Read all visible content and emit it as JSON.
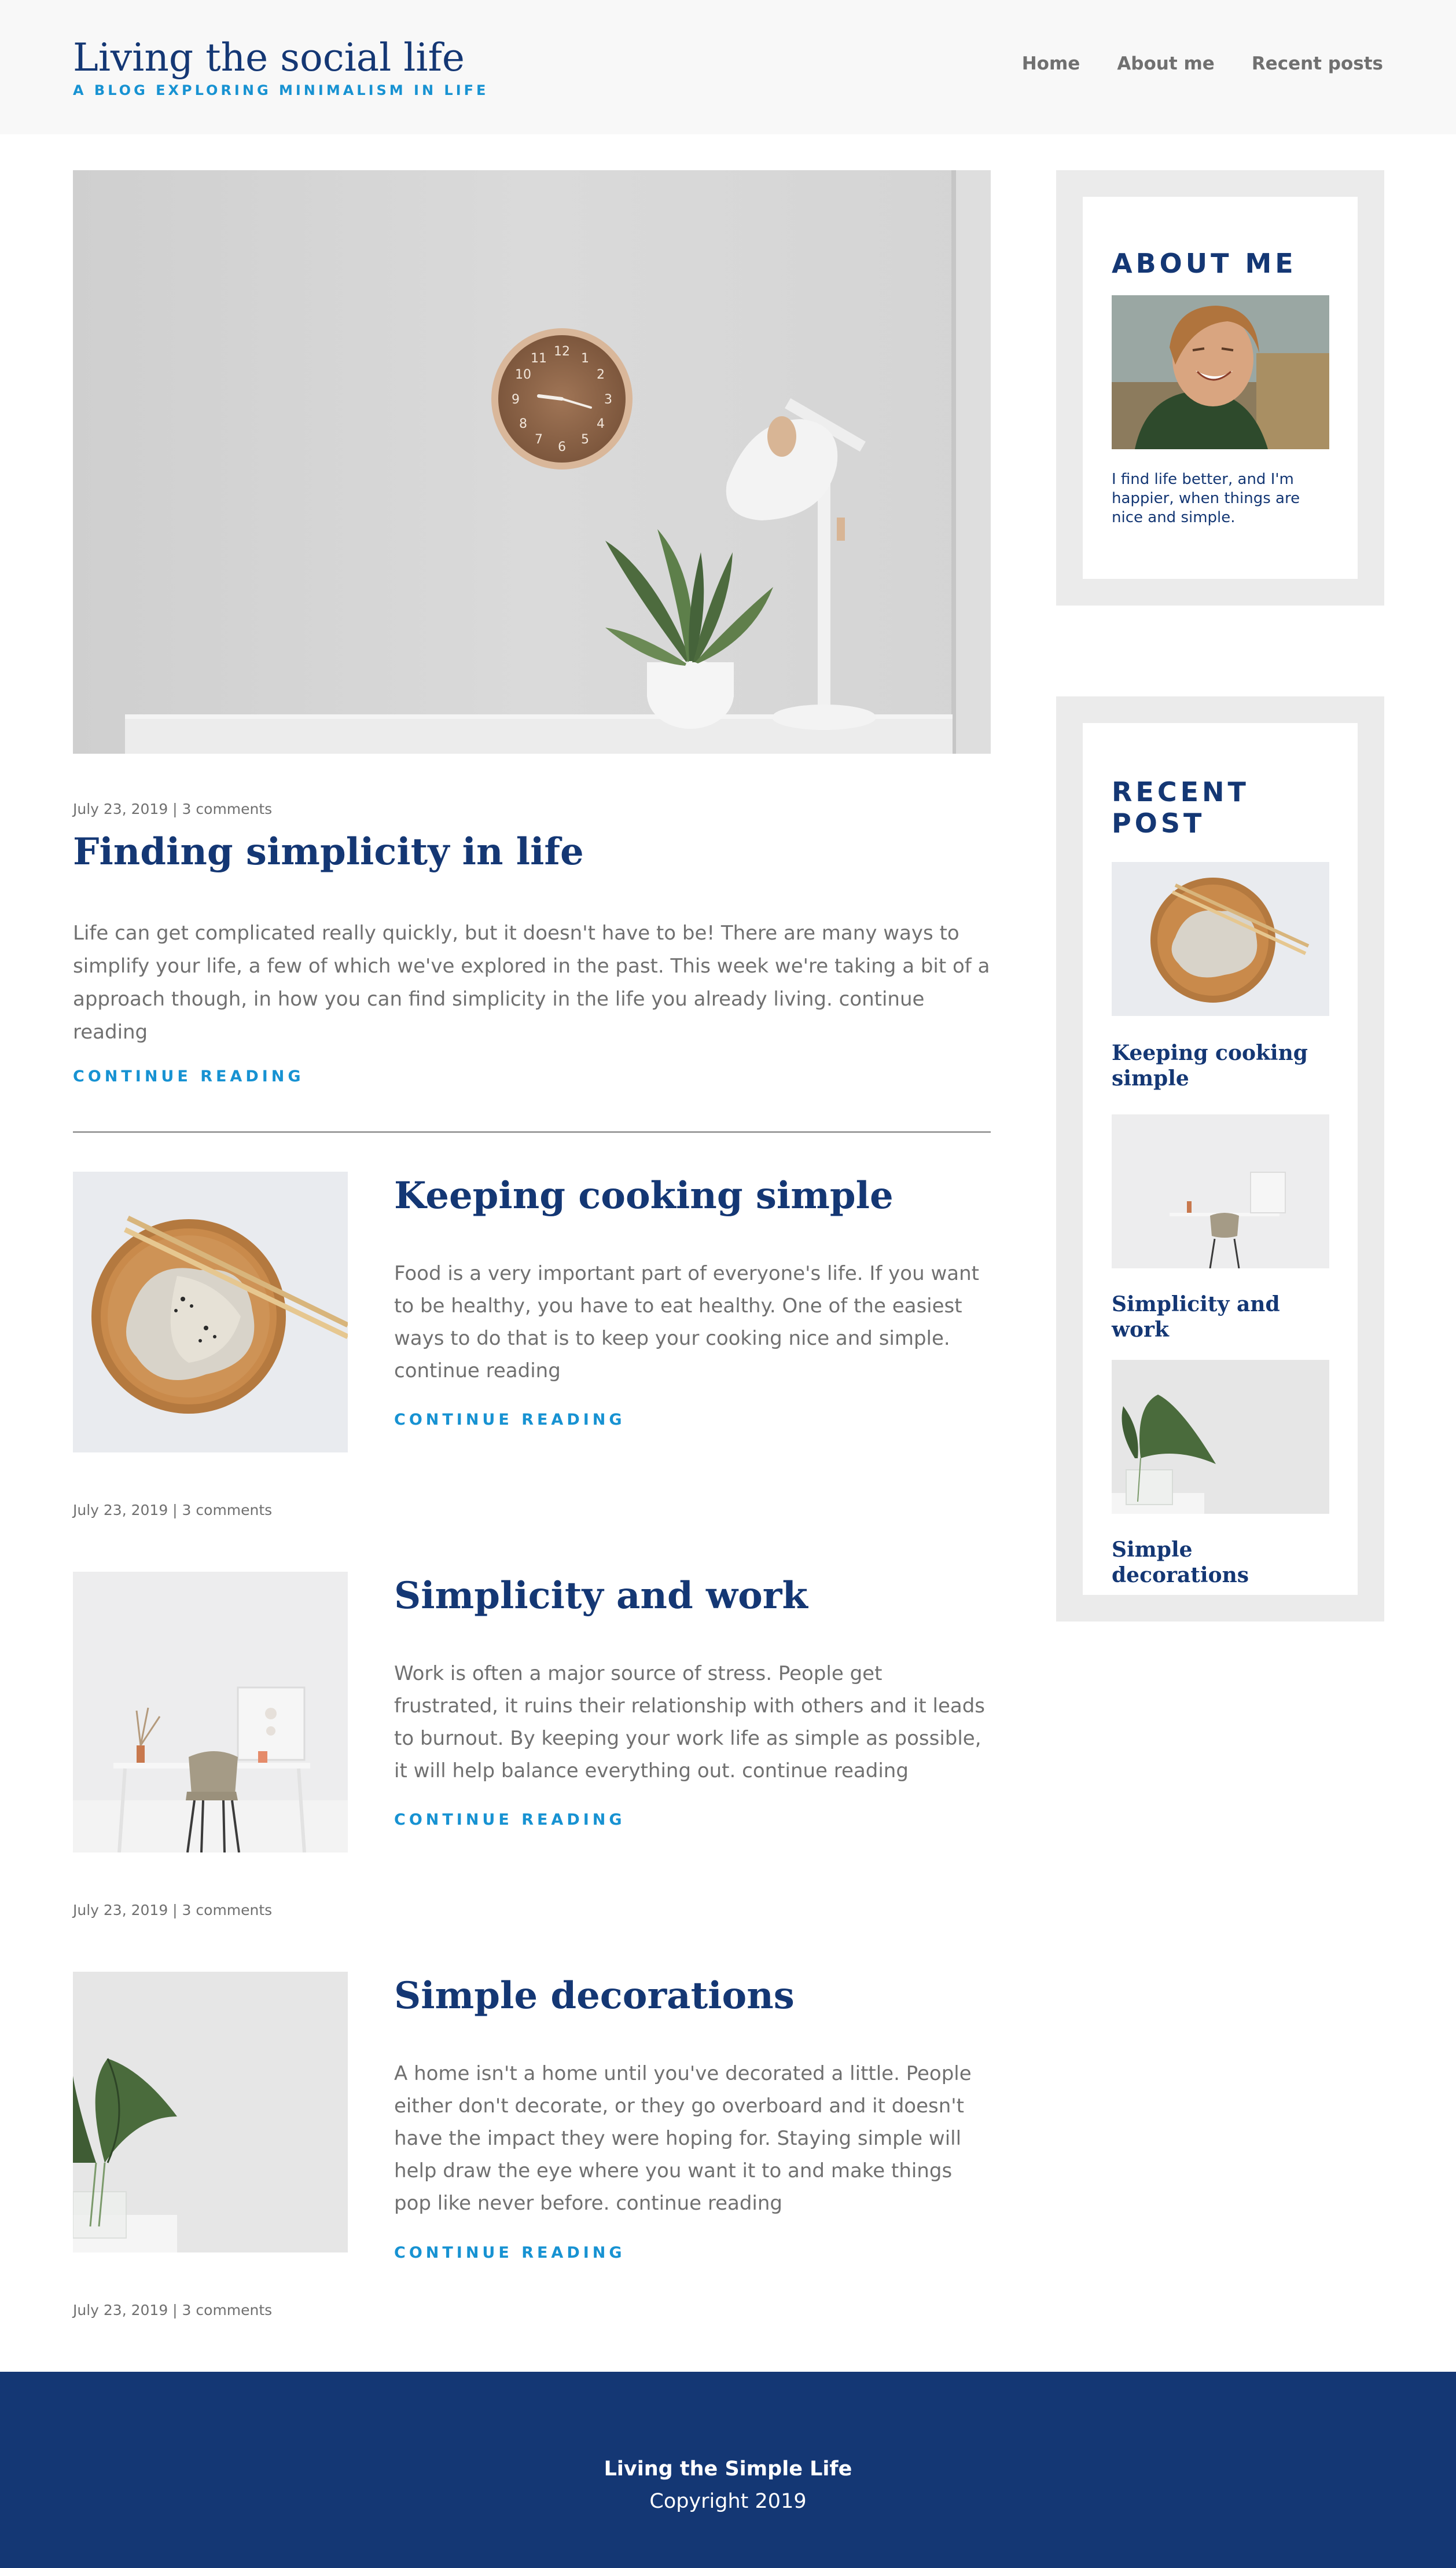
{
  "header": {
    "site_title": "Living the social life",
    "tagline": "A BLOG EXPLORING MINIMALISM IN LIFE",
    "nav": [
      "Home",
      "About me",
      "Recent posts"
    ]
  },
  "featured": {
    "meta": "July 23, 2019 | 3 comments",
    "title": "Finding simplicity in life",
    "excerpt": "Life can get complicated really quickly, but it doesn't have to be! There are many ways to simplify your life, a few of which we've explored in the past. This week we're taking a bit of a approach though, in how you can find simplicity in the life you already living. continue reading",
    "cta": "CONTINUE READING"
  },
  "posts": [
    {
      "title": "Keeping cooking simple",
      "excerpt": "Food is a very important part of everyone's life. If you want to be healthy, you have to eat healthy. One of the easiest ways to do that is to keep your cooking nice and simple. continue reading",
      "cta": "CONTINUE READING",
      "meta": "July 23, 2019 | 3 comments"
    },
    {
      "title": "Simplicity and work",
      "excerpt": "Work is often a major source of stress. People get frustrated, it ruins their relationship with others and it leads to burnout. By keeping your work life as simple as possible, it will help balance everything out. continue reading",
      "cta": "CONTINUE READING",
      "meta": "July 23, 2019 | 3 comments"
    },
    {
      "title": "Simple decorations",
      "excerpt": "A home isn't a home until you've decorated a little. People either don't decorate, or they go overboard and it doesn't have the impact they were hoping for. Staying simple will help draw the eye where you want it to and make things pop like never before. continue reading",
      "cta": "CONTINUE READING",
      "meta": "July 23, 2019 | 3 comments"
    }
  ],
  "sidebar": {
    "about": {
      "title": "ABOUT ME",
      "text": "I find life better, and I'm happier, when things are nice and simple."
    },
    "recent": {
      "title": "RECENT POST",
      "items": [
        "Keeping cooking simple",
        "Simplicity and work",
        "Simple decorations"
      ]
    }
  },
  "footer": {
    "brand": "Living the Simple Life",
    "copyright": "Copyright 2019"
  },
  "colors": {
    "primary": "#143774",
    "accent": "#1792d2",
    "text": "#707070",
    "header_bg": "#f8f8f8",
    "widget_bg": "#ebebeb"
  }
}
